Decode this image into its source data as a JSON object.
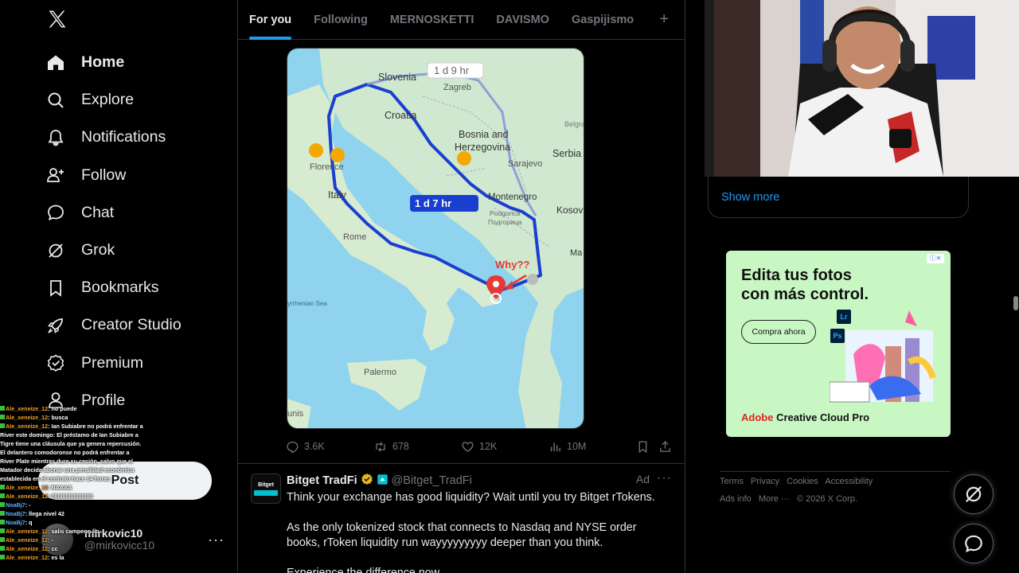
{
  "sidebar": {
    "items": [
      {
        "label": "Home",
        "icon": "home-icon"
      },
      {
        "label": "Explore",
        "icon": "search-icon"
      },
      {
        "label": "Notifications",
        "icon": "bell-icon"
      },
      {
        "label": "Follow",
        "icon": "follow-icon"
      },
      {
        "label": "Chat",
        "icon": "chat-icon"
      },
      {
        "label": "Grok",
        "icon": "grok-icon"
      },
      {
        "label": "Bookmarks",
        "icon": "bookmark-icon"
      },
      {
        "label": "Creator Studio",
        "icon": "rocket-icon"
      },
      {
        "label": "Premium",
        "icon": "verified-icon"
      },
      {
        "label": "Profile",
        "icon": "person-icon"
      }
    ],
    "post_label": "Post",
    "account": {
      "name": "mirkovic10",
      "handle": "@mirkovicc10"
    }
  },
  "chat_overlay": [
    {
      "user": "Ale_xeneize_12",
      "msg": ": no puede"
    },
    {
      "user": "Ale_xeneize_12",
      "msg": ": busca"
    },
    {
      "user": "Ale_xeneize_12",
      "msg": ": Ian Subiabre no podrá enfrentar a River este domingo: El préstamo de Ian Subiabre a Tigre tiene una cláusula que ya genera repercusión. El delantero comodoronse no podrá enfrentar a River Plate mientras dure su cesión, salvo que el Matador decida abonar una penalidad económica establecida en el contrato hace 14 horas"
    },
    {
      "user": "Ale_xeneize_12",
      "msg": ": NAAAA"
    },
    {
      "user": "Ale_xeneize_12",
      "msg": ": 0000000000000"
    },
    {
      "user": "NoaBj7",
      "msg": ": -"
    },
    {
      "user": "NoaBj7",
      "msg": ": llega nivel 42"
    },
    {
      "user": "NoaBj7",
      "msg": ": q"
    },
    {
      "user": "Ale_xeneize_12",
      "msg": ": salis campeon lio"
    },
    {
      "user": "Ale_xeneize_12",
      "msg": ": -"
    },
    {
      "user": "Ale_xeneize_12",
      "msg": ": cc"
    },
    {
      "user": "Ale_xeneize_12",
      "msg": ": es la"
    }
  ],
  "tabs": [
    "For you",
    "Following",
    "MERNOSKETTI",
    "DAVISMO",
    "Gaspijismo"
  ],
  "tab_plus": "+",
  "map": {
    "route_top_label": "1 d 9 hr",
    "route_main_label": "1 d 7 hr",
    "annotation": "Why??",
    "places": {
      "slovenia": "Slovenia",
      "zagreb": "Zagreb",
      "croatia": "Croatia",
      "bosnia1": "Bosnia and",
      "bosnia2": "Herzegovina",
      "sarajevo": "Sarajevo",
      "serbia": "Serbia",
      "belgrade": "Belgrad",
      "florence": "Florence",
      "italy": "Italy",
      "rome": "Rome",
      "montenegro": "Montenegro",
      "podgorica1": "Podgorica",
      "podgorica2": "Подгорица",
      "kosovo": "Kosov",
      "tyrrhenian": "yrrhenian Sea",
      "palermo": "Palermo",
      "tunis": "unis",
      "mac": "Ma"
    }
  },
  "tweet_actions": {
    "replies": "3.6K",
    "reposts": "678",
    "likes": "12K",
    "views": "10M"
  },
  "ad_tweet": {
    "name": "Bitget TradFi",
    "handle": "@Bitget_TradFi",
    "ad_label": "Ad",
    "avatar_text": "Bitget",
    "line1": "Think your exchange has good liquidity? Wait until you try Bitget rTokens.",
    "line2": "As the only tokenized stock that connects to Nasdaq and NYSE order books, rToken liquidity run wayyyyyyyyy deeper than you think.",
    "line3": "Experience the difference now"
  },
  "right": {
    "show_more": "Show more",
    "promo": {
      "headline1": "Edita tus fotos",
      "headline2": "con más control.",
      "cta": "Compra ahora",
      "brand_red": "Adobe",
      "brand_rest": " Creative Cloud Pro",
      "lr": "Lr",
      "ps": "Ps"
    },
    "footer": [
      "Terms",
      "Privacy",
      "Cookies",
      "Accessibility",
      "Ads info",
      "More ···",
      "© 2026 X Corp."
    ]
  },
  "colors": {
    "accent": "#1d9bf0",
    "route": "#1a3fd0",
    "sea": "#8fd3ee",
    "land": "#cfe8cf",
    "promo_bg": "#c9f7c3"
  }
}
